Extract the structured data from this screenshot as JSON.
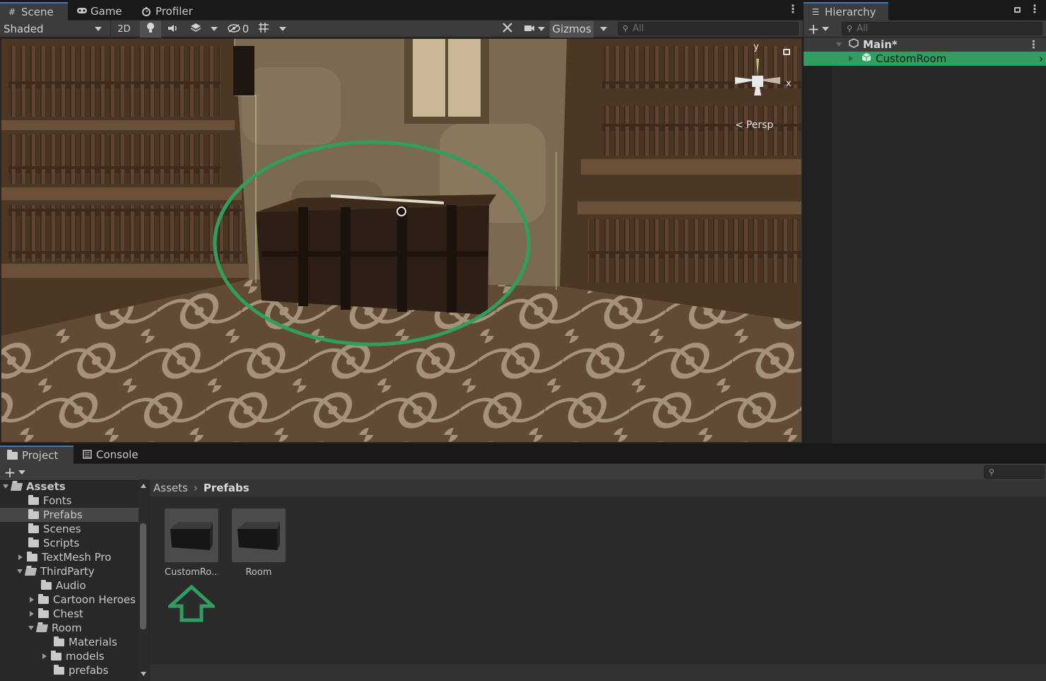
{
  "scene_panel": {
    "tabs": [
      {
        "label": "Scene",
        "icon": "grid-icon"
      },
      {
        "label": "Game",
        "icon": "gamepad-icon"
      },
      {
        "label": "Profiler",
        "icon": "profiler-icon"
      }
    ],
    "toolbar": {
      "draw_mode": "Shaded",
      "mode_2d": "2D",
      "hidden_count": "0",
      "gizmos": "Gizmos",
      "search_placeholder": "All"
    },
    "viewport": {
      "orientation_label": "Persp",
      "axis_y": "y",
      "axis_x": "x",
      "annotation_color": "#2f9e5f"
    }
  },
  "hierarchy": {
    "tab_label": "Hierarchy",
    "search_placeholder": "All",
    "items": [
      {
        "label": "Main*",
        "depth": 0,
        "expanded": true
      },
      {
        "label": "CustomRoom",
        "depth": 1,
        "expanded": false,
        "selected": true
      }
    ],
    "selection_color": "#2f9e5f"
  },
  "project": {
    "tabs": [
      {
        "label": "Project",
        "icon": "folder-icon"
      },
      {
        "label": "Console",
        "icon": "console-icon"
      }
    ],
    "tree": [
      {
        "label": "Assets",
        "depth": 0,
        "expanded": true,
        "bold": true
      },
      {
        "label": "Fonts",
        "depth": 1
      },
      {
        "label": "Prefabs",
        "depth": 1,
        "selected": true
      },
      {
        "label": "Scenes",
        "depth": 1
      },
      {
        "label": "Scripts",
        "depth": 1
      },
      {
        "label": "TextMesh Pro",
        "depth": 1,
        "collapsed": true
      },
      {
        "label": "ThirdParty",
        "depth": 1,
        "expanded": true
      },
      {
        "label": "Audio",
        "depth": 2
      },
      {
        "label": "Cartoon Heroes",
        "depth": 2,
        "collapsed": true
      },
      {
        "label": "Chest",
        "depth": 2,
        "collapsed": true
      },
      {
        "label": "Room",
        "depth": 2,
        "expanded": true
      },
      {
        "label": "Materials",
        "depth": 3
      },
      {
        "label": "models",
        "depth": 3,
        "collapsed": true
      },
      {
        "label": "prefabs",
        "depth": 3
      }
    ],
    "breadcrumb": {
      "root": "Assets",
      "current": "Prefabs"
    },
    "assets": [
      {
        "label": "CustomRo..."
      },
      {
        "label": "Room"
      }
    ]
  }
}
